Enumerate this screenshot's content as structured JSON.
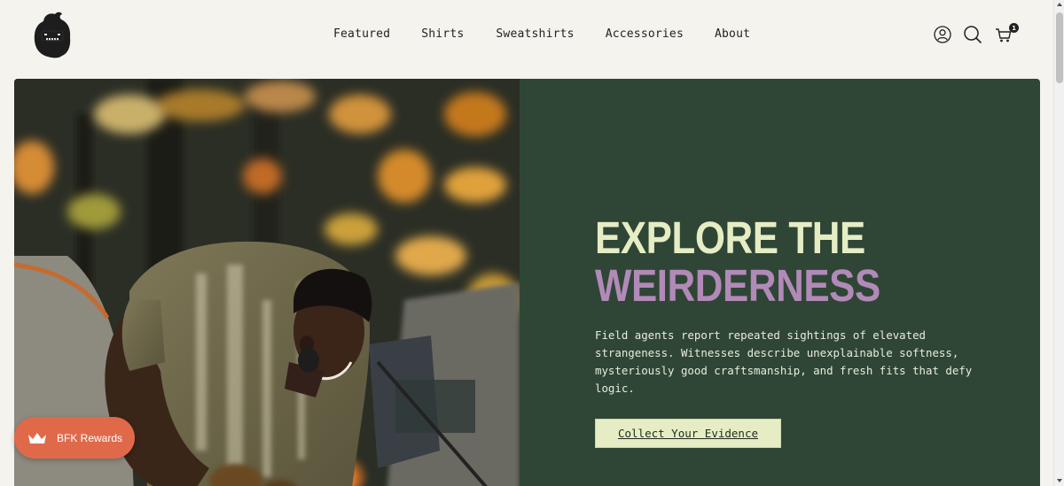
{
  "nav": {
    "items": [
      {
        "label": "Featured"
      },
      {
        "label": "Shirts"
      },
      {
        "label": "Sweatshirts"
      },
      {
        "label": "Accessories"
      },
      {
        "label": "About"
      }
    ]
  },
  "cart": {
    "count": "1"
  },
  "hero": {
    "headline_line1": "EXPLORE THE",
    "headline_line2": "WEIRDERNESS",
    "description": "Field agents report repeated sightings of elevated strangeness. Witnesses describe unexplainable softness, mysteriously good craftsmanship, and fresh fits that defy logic.",
    "cta_label": "Collect Your Evidence"
  },
  "rewards": {
    "label": "BFK Rewards"
  },
  "colors": {
    "page_bg": "#f5f3ee",
    "panel_green": "#2f4636",
    "headline_cream": "#e6edc4",
    "headline_purple": "#b18ab7",
    "rewards_orange": "#e0694a"
  }
}
